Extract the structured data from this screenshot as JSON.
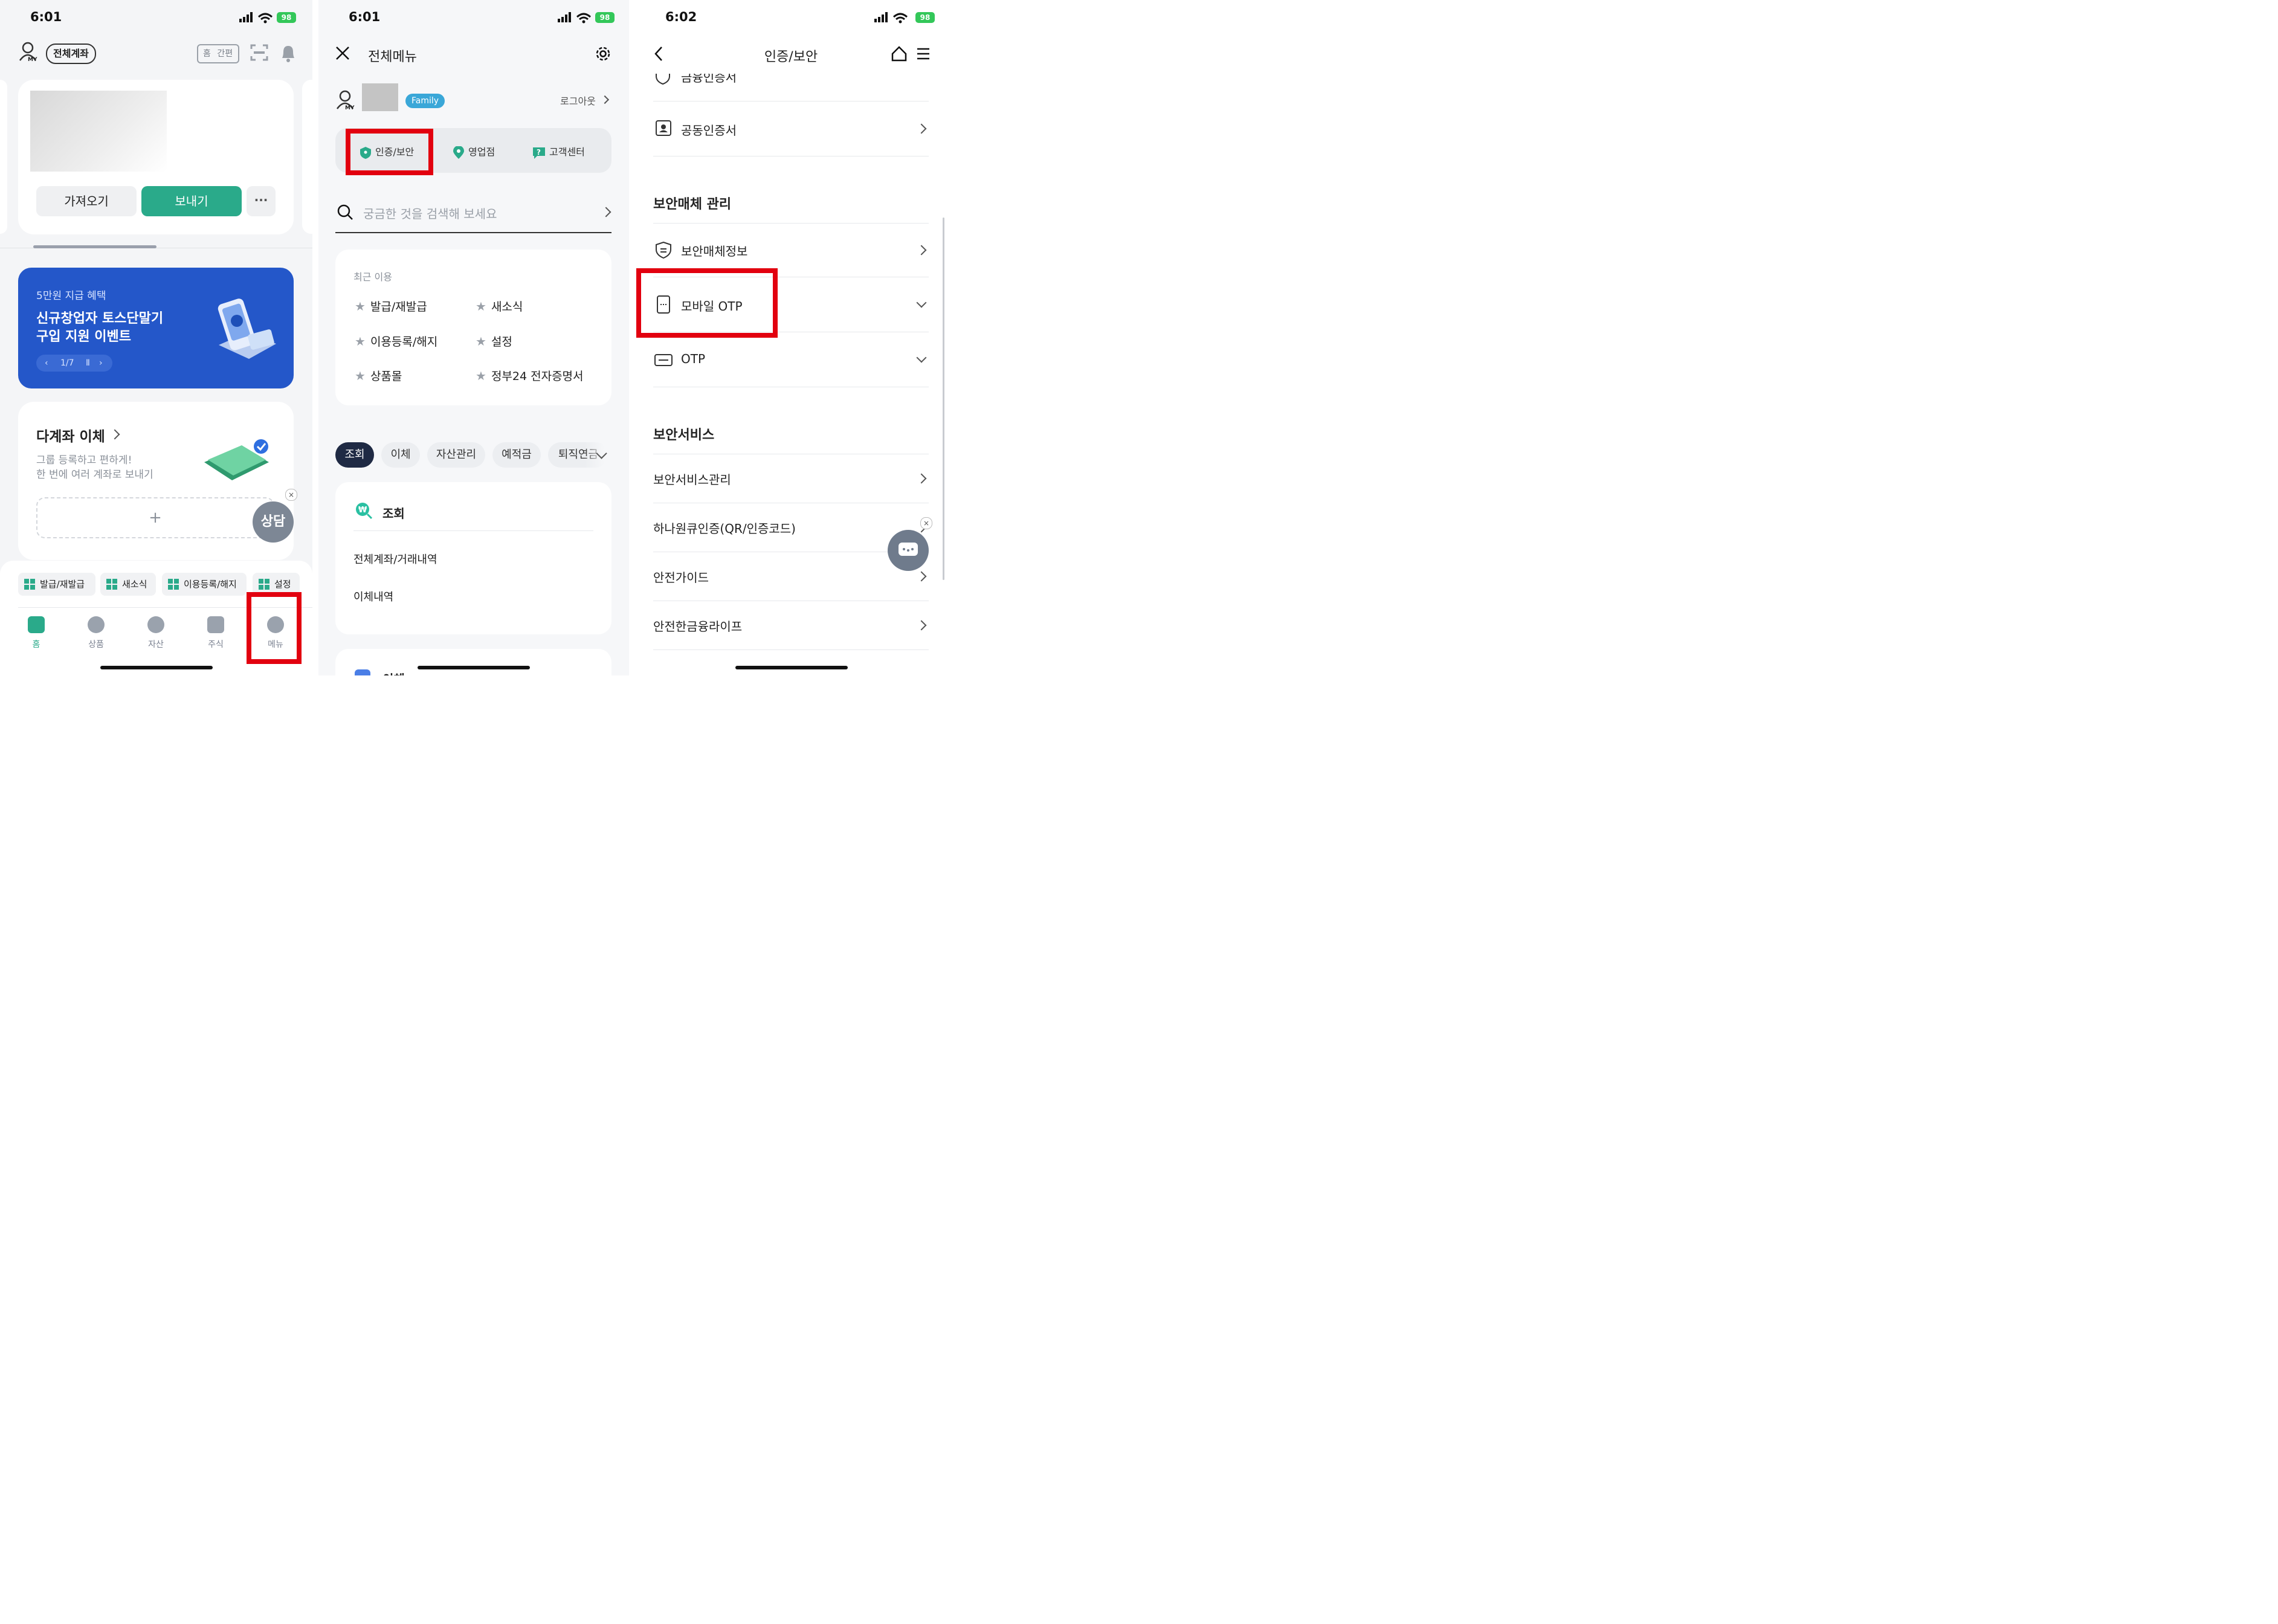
{
  "panel1": {
    "time": "6:01",
    "battery": "98",
    "header": {
      "my_label": "MY",
      "all_accounts": "전체계좌",
      "home_tag": "홈",
      "simple_tag": "간편"
    },
    "account_card": {
      "import_label": "가져오기",
      "send_label": "보내기",
      "more_label": "···"
    },
    "banner": {
      "subtitle": "5만원 지급 혜택",
      "title_line1": "신규창업자 토스단말기",
      "title_line2": "구입 지원 이벤트",
      "pager": "1/7",
      "color": "#2457c9"
    },
    "multi_transfer": {
      "title": "다계좌 이체",
      "desc_line1": "그룹 등록하고 편하게!",
      "desc_line2": "한 번에 여러 계좌로 보내기",
      "add_label": "+"
    },
    "consult_label": "상담",
    "shortcuts": [
      "발급/재발급",
      "새소식",
      "이용등록/해지",
      "설정"
    ],
    "nav": [
      "홈",
      "상품",
      "자산",
      "주식",
      "메뉴"
    ],
    "accent": "#2aaa8a"
  },
  "panel2": {
    "time": "6:01",
    "battery": "98",
    "title": "전체메뉴",
    "my_label": "MY",
    "family_badge": "Family",
    "logout": "로그아웃",
    "quick": [
      "인증/보안",
      "영업점",
      "고객센터"
    ],
    "search_placeholder": "궁금한 것을 검색해 보세요",
    "recent_title": "최근 이용",
    "recent": [
      "발급/재발급",
      "새소식",
      "이용등록/해지",
      "설정",
      "상품몰",
      "정부24 전자증명서"
    ],
    "tabs": [
      "조회",
      "이체",
      "자산관리",
      "예적금",
      "퇴직연금"
    ],
    "section_title": "조회",
    "section_items": [
      "전체계좌/거래내역",
      "이체내역"
    ],
    "next_section": "이체"
  },
  "panel3": {
    "time": "6:02",
    "battery": "98",
    "title": "인증/보안",
    "cut_item": "금융인증서",
    "cert_item": "공동인증서",
    "media_header": "보안매체 관리",
    "media_items": [
      "보안매체정보",
      "모바일 OTP",
      "OTP"
    ],
    "service_header": "보안서비스",
    "service_items": [
      "보안서비스관리",
      "하나원큐인증(QR/인증코드)",
      "안전가이드",
      "안전한금융라이프"
    ]
  }
}
